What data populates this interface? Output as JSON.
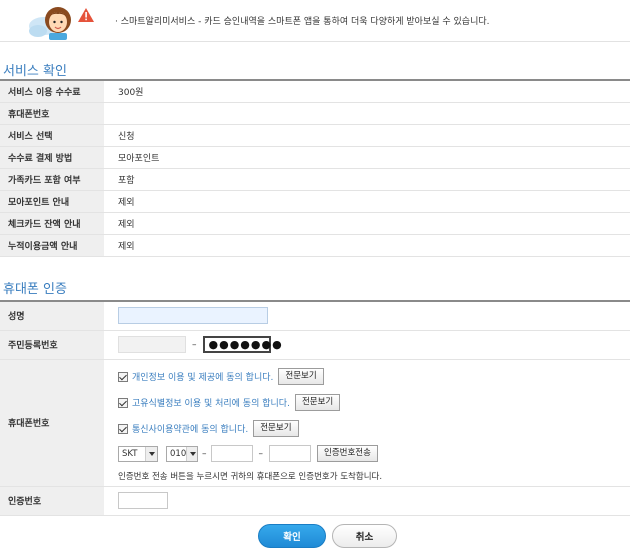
{
  "banner": {
    "notice": "· 스마트알리미서비스 - 카드 승인내역을 스마트폰 앱을 통하여 더욱 다양하게 받아보실 수 있습니다."
  },
  "service": {
    "title": "서비스 확인",
    "rows": [
      {
        "label": "서비스 이용 수수료",
        "value": "300원"
      },
      {
        "label": "휴대폰번호",
        "value": ""
      },
      {
        "label": "서비스 선택",
        "value": "신청"
      },
      {
        "label": "수수료 결제 방법",
        "value": "모아포인트"
      },
      {
        "label": "가족카드 포함 여부",
        "value": "포함"
      },
      {
        "label": "모아포인트 안내",
        "value": "제외"
      },
      {
        "label": "체크카드 잔액 안내",
        "value": "제외"
      },
      {
        "label": "누적이용금액 안내",
        "value": "제외"
      }
    ]
  },
  "auth": {
    "title": "휴대폰 인증",
    "name_label": "성명",
    "rrn_label": "주민등록번호",
    "rrn_back": "●●●●●●●",
    "phone_label": "휴대폰번호",
    "agree_privacy": "개인정보 이용 및 제공에 동의 합니다.",
    "agree_unique_id": "고유식별정보 이용 및 처리에 동의 합니다.",
    "agree_telecom": "통신사이용약관에 동의 합니다.",
    "view_full": "전문보기",
    "carrier": "SKT",
    "prefix": "010",
    "send_code": "인증번호전송",
    "hint": "인증번호 전송 버튼을 누르시면 귀하의 휴대폰으로 인증번호가 도착합니다.",
    "code_label": "인증번호"
  },
  "actions": {
    "confirm": "확인",
    "cancel": "취소"
  },
  "colors": {
    "accent": "#3a7ebf",
    "confirm_button": "#2599e2"
  }
}
